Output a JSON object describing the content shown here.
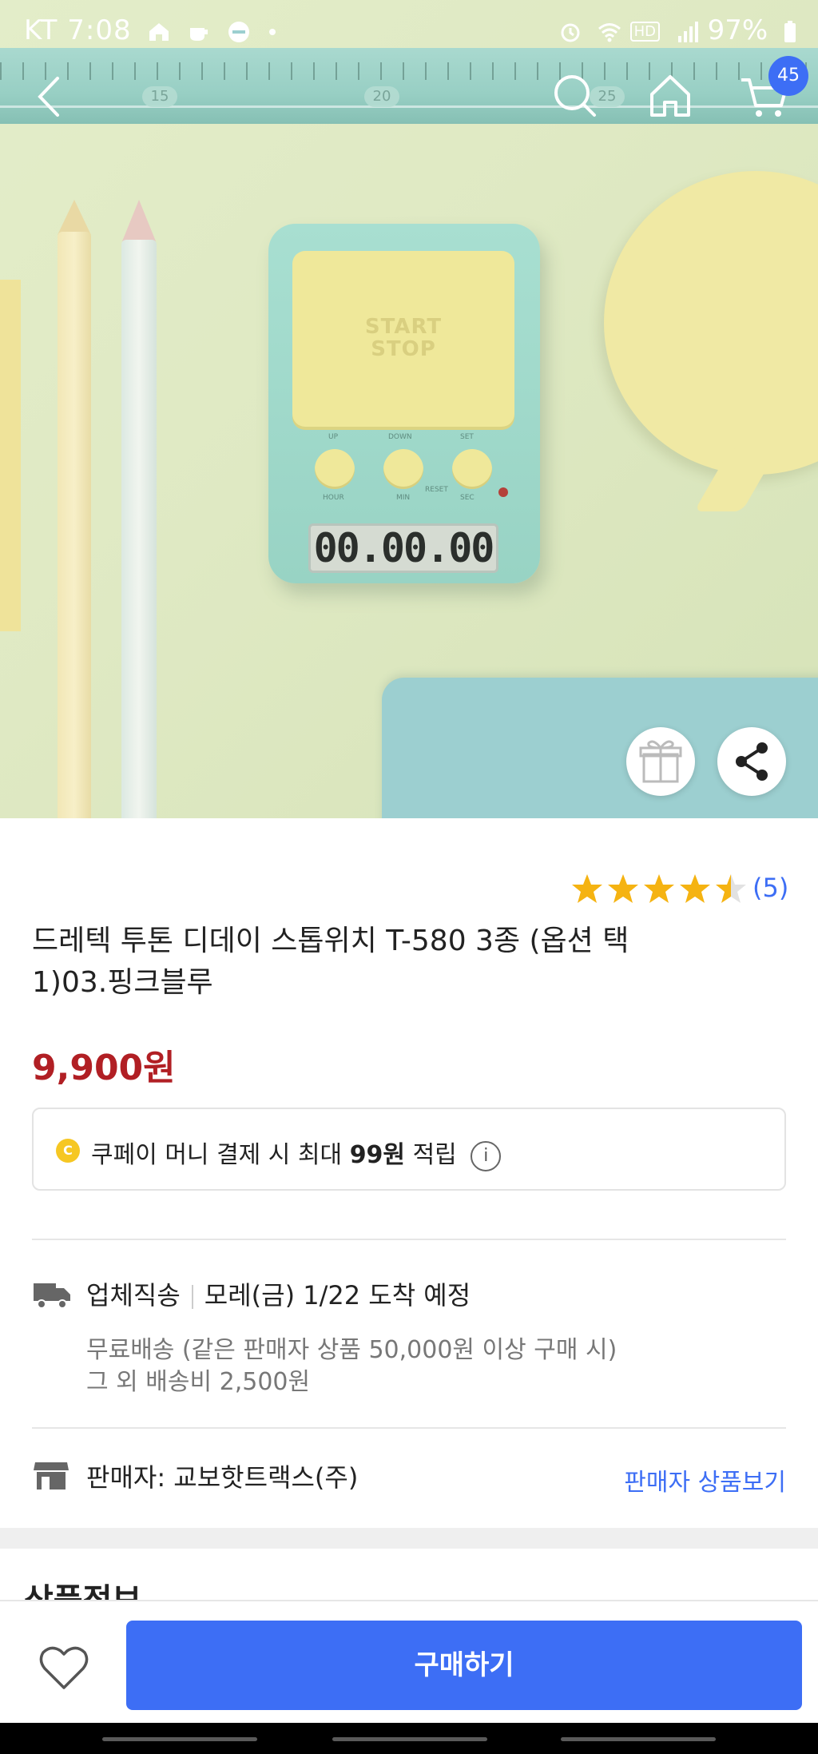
{
  "status_bar": {
    "carrier_time": "KT 7:08",
    "battery": "97%",
    "hd": "HD"
  },
  "hero": {
    "ruler_numbers": [
      "15",
      "20",
      "25"
    ],
    "timer_pad_line1": "START",
    "timer_pad_line2": "STOP",
    "timer_labels": [
      "UP",
      "DOWN",
      "SET",
      "HOUR",
      "MIN",
      "SEC",
      "RESET"
    ],
    "timer_display": "00.00.00"
  },
  "nav": {
    "cart_count": "45"
  },
  "rating": {
    "value": 4.5,
    "max": 5,
    "review_count": "(5)",
    "star_color": "#f5b312"
  },
  "product": {
    "title": "드레텍 투톤 디데이 스톱위치 T-580 3종 (옵션 택1)03.핑크블루",
    "price": "9,900원"
  },
  "cpay": {
    "coin": "C",
    "text_before": "쿠페이 머니 결제 시 최대 ",
    "amount": "99원",
    "text_after": " 적립",
    "info": "i"
  },
  "shipping": {
    "method": "업체직송",
    "arrival": "모레(금) 1/22 도착 예정",
    "free_line": "무료배송 (같은 판매자 상품 50,000원 이상 구매 시)",
    "fee_line": "그 외 배송비 2,500원"
  },
  "seller": {
    "label": "판매자: 교보핫트랙스(주)",
    "link": "판매자 상품보기"
  },
  "section": {
    "title": "상품정보"
  },
  "bottom_bar": {
    "buy_label": "구매하기"
  },
  "colors": {
    "accent": "#3d6ef5",
    "price": "#b11f24"
  }
}
